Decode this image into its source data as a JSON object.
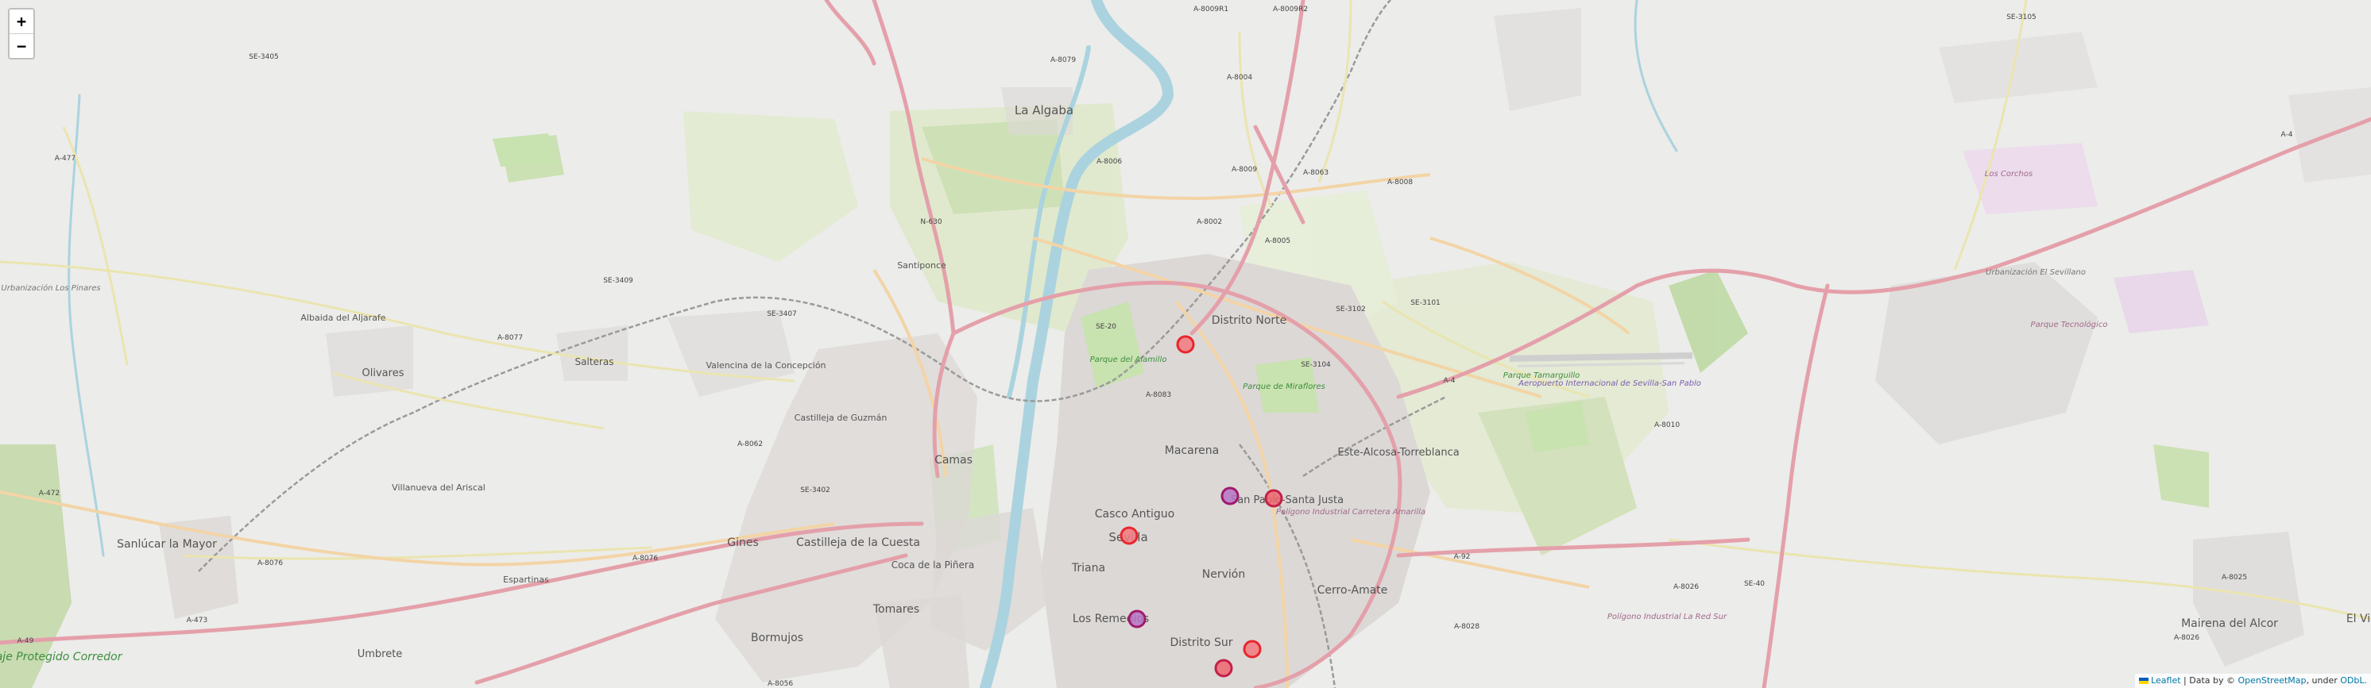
{
  "map": {
    "place_labels": [
      {
        "id": "la-algaba",
        "text": "La Algaba"
      },
      {
        "id": "santiponce",
        "text": "Santiponce"
      },
      {
        "id": "albaida",
        "text": "Albaida del Aljarafe"
      },
      {
        "id": "olivares",
        "text": "Olivares"
      },
      {
        "id": "salteras",
        "text": "Salteras"
      },
      {
        "id": "valencina",
        "text": "Valencina de la Concepción"
      },
      {
        "id": "castilleja-guzman",
        "text": "Castilleja de Guzmán"
      },
      {
        "id": "camas",
        "text": "Camas"
      },
      {
        "id": "villanueva",
        "text": "Villanueva del Ariscal"
      },
      {
        "id": "sanlucar",
        "text": "Sanlúcar la Mayor"
      },
      {
        "id": "gines",
        "text": "Gines"
      },
      {
        "id": "castilleja-cuesta",
        "text": "Castilleja de la Cuesta"
      },
      {
        "id": "espartinas",
        "text": "Espartinas"
      },
      {
        "id": "coca-pinera",
        "text": "Coca de la Piñera"
      },
      {
        "id": "tomares",
        "text": "Tomares"
      },
      {
        "id": "bormujos",
        "text": "Bormujos"
      },
      {
        "id": "umbrete",
        "text": "Umbrete"
      },
      {
        "id": "distrito-norte",
        "text": "Distrito Norte"
      },
      {
        "id": "macarena",
        "text": "Macarena"
      },
      {
        "id": "casco-antiguo",
        "text": "Casco Antiguo"
      },
      {
        "id": "sevilla",
        "text": "Sevilla"
      },
      {
        "id": "triana",
        "text": "Triana"
      },
      {
        "id": "los-remedios",
        "text": "Los Remedios"
      },
      {
        "id": "distrito-sur",
        "text": "Distrito Sur"
      },
      {
        "id": "nervion",
        "text": "Nervión"
      },
      {
        "id": "san-pablo",
        "text": "San Pablo-Santa Justa"
      },
      {
        "id": "este-alcosa",
        "text": "Este-Alcosa-Torreblanca"
      },
      {
        "id": "cerro-amate",
        "text": "Cerro-Amate"
      },
      {
        "id": "mairena-alcor",
        "text": "Mairena del Alcor"
      },
      {
        "id": "el-viso",
        "text": "El Vi"
      },
      {
        "id": "paisaje",
        "text": "Paisaje Protegido Corredor"
      },
      {
        "id": "parque-alamillo",
        "text": "Parque del Alamillo"
      },
      {
        "id": "parque-miraflores",
        "text": "Parque de Miraflores"
      },
      {
        "id": "parque-tamarguillo",
        "text": "Parque Tamarguillo"
      },
      {
        "id": "aeropuerto",
        "text": "Aeropuerto Internacional de Sevilla-San Pablo"
      },
      {
        "id": "poligono-carretera",
        "text": "Polígono Industrial Carretera Amarilla"
      },
      {
        "id": "poligono-la-red",
        "text": "Polígono Industrial La Red Sur"
      },
      {
        "id": "urb-pinares",
        "text": "Urbanización Los Pinares"
      },
      {
        "id": "urb-sevilla",
        "text": "Urbanización El Sevillano"
      },
      {
        "id": "los-corchos",
        "text": "Los Corchos"
      },
      {
        "id": "parque-tecnologico",
        "text": "Parque Tecnológico"
      }
    ],
    "road_labels": [
      {
        "id": "a477",
        "text": "A-477"
      },
      {
        "id": "se3405",
        "text": "SE-3405"
      },
      {
        "id": "se3409",
        "text": "SE-3409"
      },
      {
        "id": "se3407",
        "text": "SE-3407"
      },
      {
        "id": "a8077",
        "text": "A-8077"
      },
      {
        "id": "a8062",
        "text": "A-8062"
      },
      {
        "id": "se3402",
        "text": "SE-3402"
      },
      {
        "id": "a472",
        "text": "A-472"
      },
      {
        "id": "a8076",
        "text": "A-8076"
      },
      {
        "id": "a8076b",
        "text": "A-8076"
      },
      {
        "id": "a473",
        "text": "A-473"
      },
      {
        "id": "a49",
        "text": "A-49"
      },
      {
        "id": "a8056",
        "text": "A-8056"
      },
      {
        "id": "a8079",
        "text": "A-8079"
      },
      {
        "id": "a8004",
        "text": "A-8004"
      },
      {
        "id": "a8006",
        "text": "A-8006"
      },
      {
        "id": "a8009",
        "text": "A-8009"
      },
      {
        "id": "a8002",
        "text": "A-8002"
      },
      {
        "id": "a8005",
        "text": "A-8005"
      },
      {
        "id": "a8063",
        "text": "A-8063"
      },
      {
        "id": "a8008",
        "text": "A-8008"
      },
      {
        "id": "n630",
        "text": "N-630"
      },
      {
        "id": "se20",
        "text": "SE-20"
      },
      {
        "id": "a8083",
        "text": "A-8083"
      },
      {
        "id": "se3102",
        "text": "SE-3102"
      },
      {
        "id": "se3104",
        "text": "SE-3104"
      },
      {
        "id": "se3101",
        "text": "SE-3101"
      },
      {
        "id": "a4",
        "text": "A-4"
      },
      {
        "id": "a4b",
        "text": "A-4"
      },
      {
        "id": "a92",
        "text": "A-92"
      },
      {
        "id": "a8026",
        "text": "A-8026"
      },
      {
        "id": "a8028",
        "text": "A-8028"
      },
      {
        "id": "a8010",
        "text": "A-8010"
      },
      {
        "id": "se40",
        "text": "SE-40"
      },
      {
        "id": "a8025",
        "text": "A-8025"
      },
      {
        "id": "a8026b",
        "text": "A-8026"
      },
      {
        "id": "se3105",
        "text": "SE-3105"
      },
      {
        "id": "a8009r1",
        "text": "A-8009R1"
      },
      {
        "id": "a8009r2",
        "text": "A-8009R2"
      }
    ],
    "markers": [
      {
        "id": "m1",
        "color": "#e8262e",
        "fill": "#f27a7f"
      },
      {
        "id": "m2",
        "color": "#a0196b",
        "fill": "#b774c5"
      },
      {
        "id": "m3",
        "color": "#c22148",
        "fill": "#ee6670"
      },
      {
        "id": "m4",
        "color": "#e8262e",
        "fill": "#f27a7f"
      },
      {
        "id": "m5",
        "color": "#a0196b",
        "fill": "#b774c5"
      },
      {
        "id": "m6",
        "color": "#e8262e",
        "fill": "#f27a7f"
      },
      {
        "id": "m7",
        "color": "#c22148",
        "fill": "#ee6670"
      }
    ]
  },
  "controls": {
    "zoom_in": "+",
    "zoom_out": "−"
  },
  "attribution": {
    "leaflet": "Leaflet",
    "separator": " | Data by © ",
    "osm": "OpenStreetMap",
    "under": ", under ",
    "odbl": "ODbL."
  },
  "colors": {
    "land": "#ececea",
    "motorway": "#e8a2ac",
    "primary": "#f5d4a4",
    "secondary": "#f6f3c0",
    "river": "#aad3df",
    "park": "#c8e2b0",
    "urban": "#dcd8d6",
    "rail": "#999999"
  }
}
